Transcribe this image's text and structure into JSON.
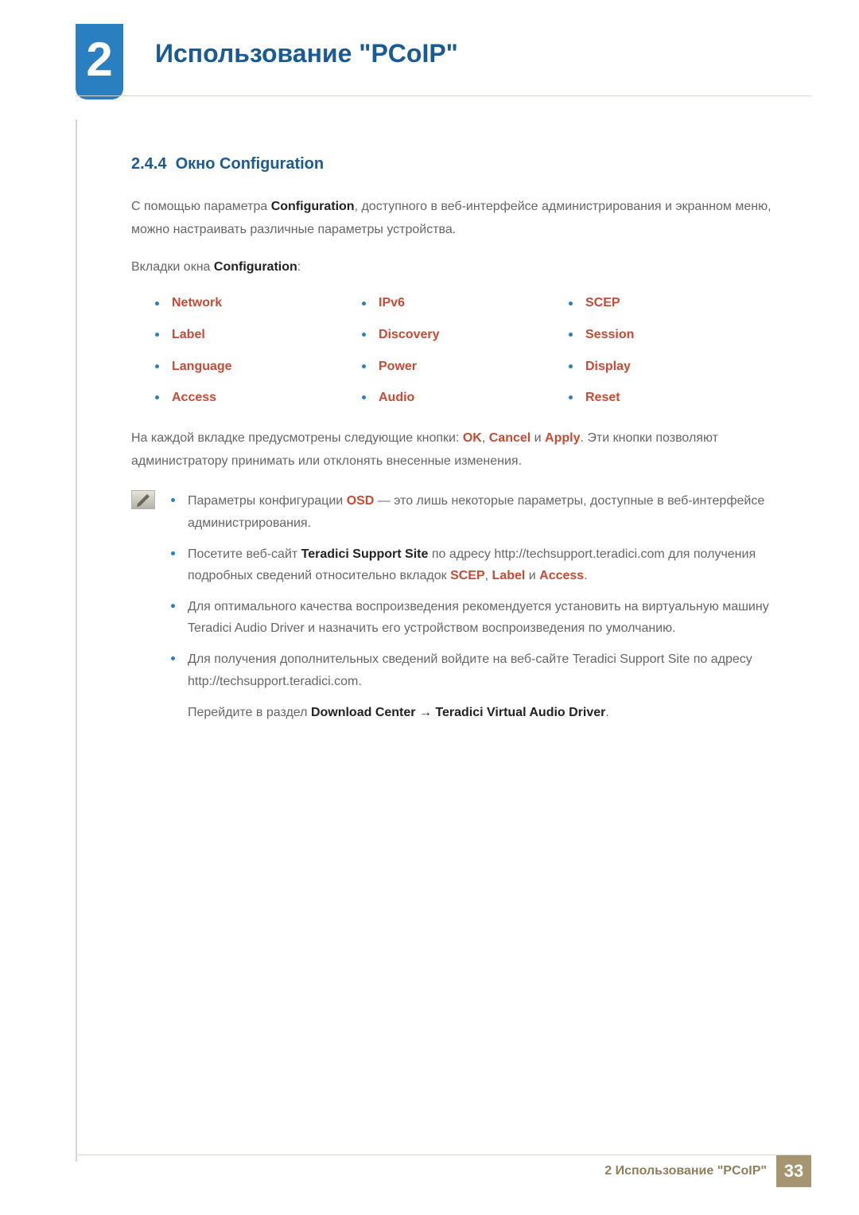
{
  "chapter": {
    "number": "2",
    "title": "Использование \"PCoIP\""
  },
  "section": {
    "number": "2.4.4",
    "title": "Окно Configuration"
  },
  "intro": {
    "pre": "С помощью параметра ",
    "bold": "Configuration",
    "post": ", доступного в веб-интерфейсе администрирования и экранном меню, можно настраивать различные параметры устройства."
  },
  "tabs_intro": {
    "pre": "Вкладки окна ",
    "bold": "Configuration",
    "post": ":"
  },
  "tabs": [
    "Network",
    "IPv6",
    "SCEP",
    "Label",
    "Discovery",
    "Session",
    "Language",
    "Power",
    "Display",
    "Access",
    "Audio",
    "Reset"
  ],
  "buttons_para": {
    "pre": "На каждой вкладке предусмотрены следующие кнопки: ",
    "b1": "OK",
    "sep1": ", ",
    "b2": "Cancel",
    "sep2": " и ",
    "b3": "Apply",
    "post": ". Эти кнопки позволяют администратору принимать или отклонять внесенные изменения."
  },
  "notes": {
    "n1": {
      "pre": "Параметры конфигурации ",
      "hl": "OSD",
      "post": " — это лишь некоторые параметры, доступные в веб-интерфейсе администрирования."
    },
    "n2": {
      "pre": "Посетите веб-сайт ",
      "b": "Teradici Support Site",
      "mid": " по адресу http://techsupport.teradici.com для получения подробных сведений относительно вкладок ",
      "t1": "SCEP",
      "s1": ", ",
      "t2": "Label",
      "s2": " и ",
      "t3": "Access",
      "post": "."
    },
    "n3": "Для оптимального качества воспроизведения рекомендуется установить на виртуальную машину Teradici Audio Driver и назначить его устройством воспроизведения по умолчанию.",
    "n4": {
      "line1": "Для получения дополнительных сведений войдите на веб-сайте Teradici Support Site по адресу http://techsupport.teradici.com.",
      "line2_pre": "Перейдите в раздел ",
      "dc": "Download Center",
      "arrow": " → ",
      "tv": "Teradici Virtual Audio Driver",
      "line2_post": "."
    }
  },
  "footer": {
    "text": "2 Использование \"PCoIP\"",
    "page": "33"
  }
}
